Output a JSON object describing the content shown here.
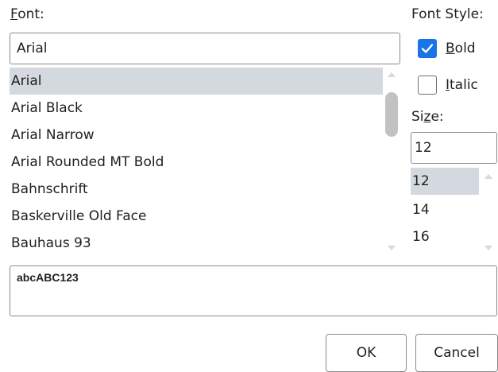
{
  "font": {
    "label_mnemonic": "F",
    "label_rest": "ont:",
    "value": "Arial",
    "items": [
      "Arial",
      "Arial Black",
      "Arial Narrow",
      "Arial Rounded MT Bold",
      "Bahnschrift",
      "Baskerville Old Face",
      "Bauhaus 93"
    ],
    "selected_index": 0
  },
  "font_style": {
    "label": "Font Style:",
    "bold": {
      "label_mnemonic": "B",
      "label_rest": "old",
      "checked": true
    },
    "italic": {
      "label_mnemonic": "I",
      "label_rest": "talic",
      "checked": false
    }
  },
  "size": {
    "label_before": "Si",
    "label_mnemonic": "z",
    "label_after": "e:",
    "value": "12",
    "items": [
      "12",
      "14",
      "16"
    ],
    "selected_index": 0
  },
  "preview": {
    "sample_text": "abcABC123"
  },
  "buttons": {
    "ok": "OK",
    "cancel": "Cancel"
  },
  "colors": {
    "selection": "#d4d9df",
    "checkbox_accent": "#1a73e8"
  }
}
